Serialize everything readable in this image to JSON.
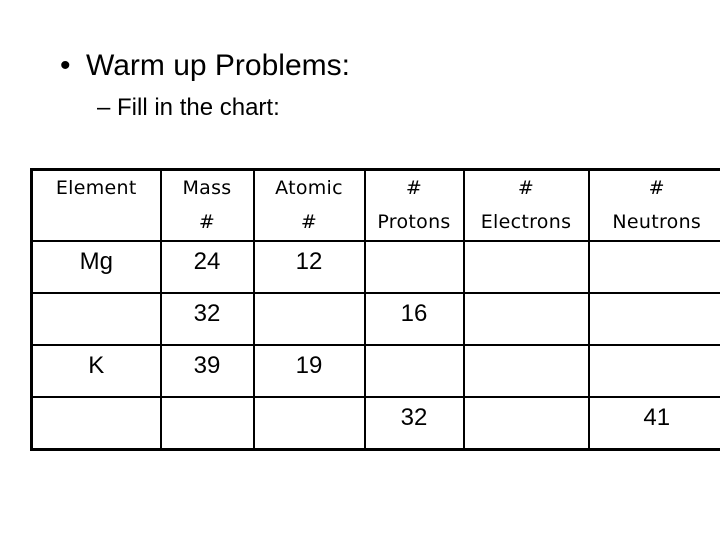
{
  "slide": {
    "bullet": "Warm up Problems:",
    "bullet_symbol": "•",
    "sub_bullet": "– Fill in the chart:"
  },
  "table": {
    "headers": [
      {
        "line1": "Element",
        "line2": ""
      },
      {
        "line1": "Mass",
        "line2": "#"
      },
      {
        "line1": "Atomic",
        "line2": "#"
      },
      {
        "line1": "#",
        "line2": "Protons"
      },
      {
        "line1": "#",
        "line2": "Electrons"
      },
      {
        "line1": "#",
        "line2": "Neutrons"
      }
    ],
    "rows": [
      [
        "Mg",
        "24",
        "12",
        "",
        "",
        ""
      ],
      [
        "",
        "32",
        "",
        "16",
        "",
        ""
      ],
      [
        "K",
        "39",
        "19",
        "",
        "",
        ""
      ],
      [
        "",
        "",
        "",
        "32",
        "",
        "41"
      ]
    ]
  }
}
